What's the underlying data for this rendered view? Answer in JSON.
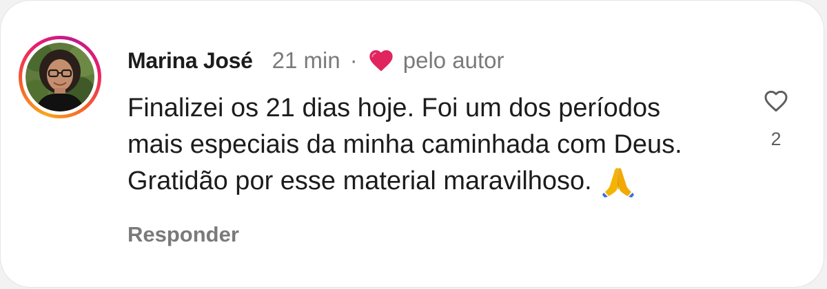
{
  "comment": {
    "author": "Marina José",
    "time": "21 min",
    "separator": "·",
    "liked_by_author_label": "pelo autor",
    "body_lines": [
      "Finalizei os 21 dias hoje. Foi um dos períodos",
      "mais especiais da minha caminhada com Deus.",
      "Gratidão por esse material maravilhoso."
    ],
    "reply_label": "Responder",
    "like_count": "2"
  },
  "colors": {
    "text_primary": "#1c1c1c",
    "text_secondary": "#7a7a7a",
    "heart_red": "#e0245e",
    "ring_gradient": [
      "#f9a51b",
      "#f5612b",
      "#e81f6c",
      "#c2188f"
    ]
  },
  "icons": {
    "author_liked": "red-heart-icon",
    "emoji": "folded-hands-icon",
    "like": "heart-outline-icon"
  }
}
